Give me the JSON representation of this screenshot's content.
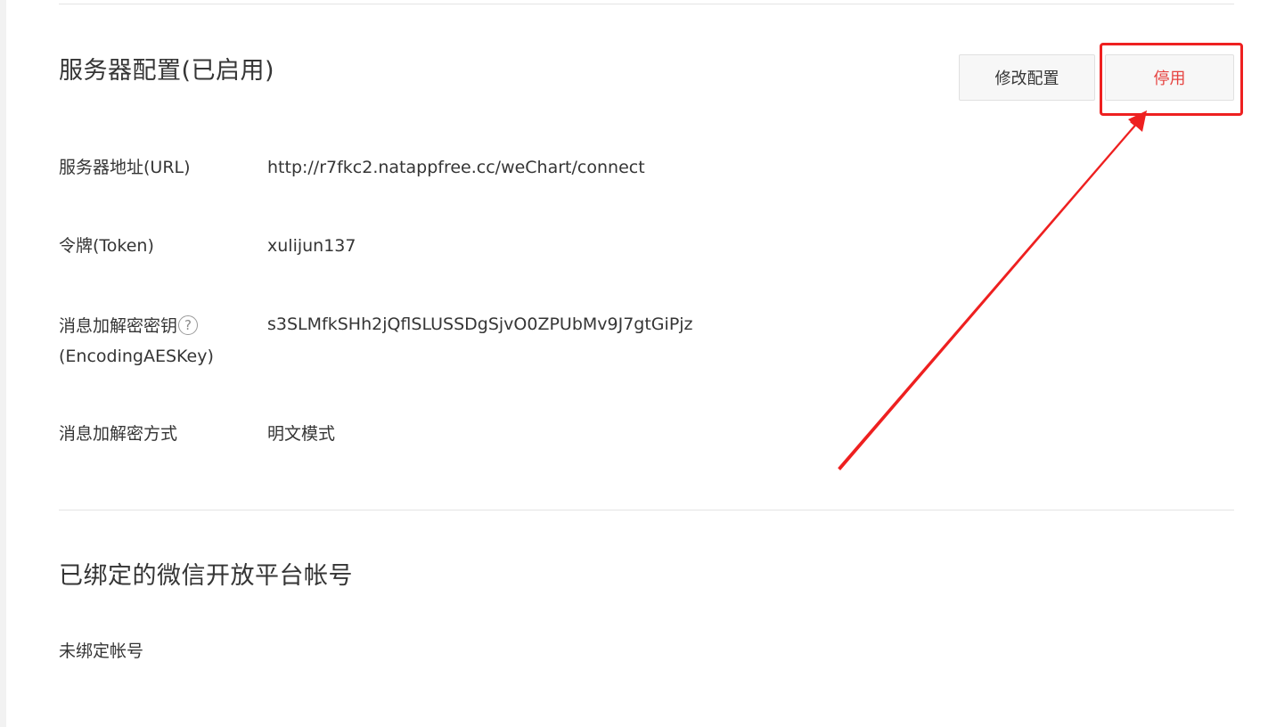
{
  "server_config": {
    "title": "服务器配置(已启用)",
    "edit_button": "修改配置",
    "disable_button": "停用",
    "fields": [
      {
        "label": "服务器地址(URL)",
        "value": "http://r7fkc2.natappfree.cc/weChart/connect"
      },
      {
        "label": "令牌(Token)",
        "value": "xulijun137"
      },
      {
        "label_line1": "消息加解密密钥",
        "label_line2": "(EncodingAESKey)",
        "help_icon": "?",
        "value": "s3SLMfkSHh2jQflSLUSSDgSjvO0ZPUbMv9J7gtGiPjz"
      },
      {
        "label": "消息加解密方式",
        "value": "明文模式"
      }
    ]
  },
  "open_platform": {
    "title": "已绑定的微信开放平台帐号",
    "status_text": "未绑定帐号"
  },
  "annotation": {
    "color": "#ee2020",
    "icon": "red-arrow-pointing-to-disable-button"
  },
  "colors": {
    "disable_text": "#e64340",
    "text": "#353535"
  }
}
